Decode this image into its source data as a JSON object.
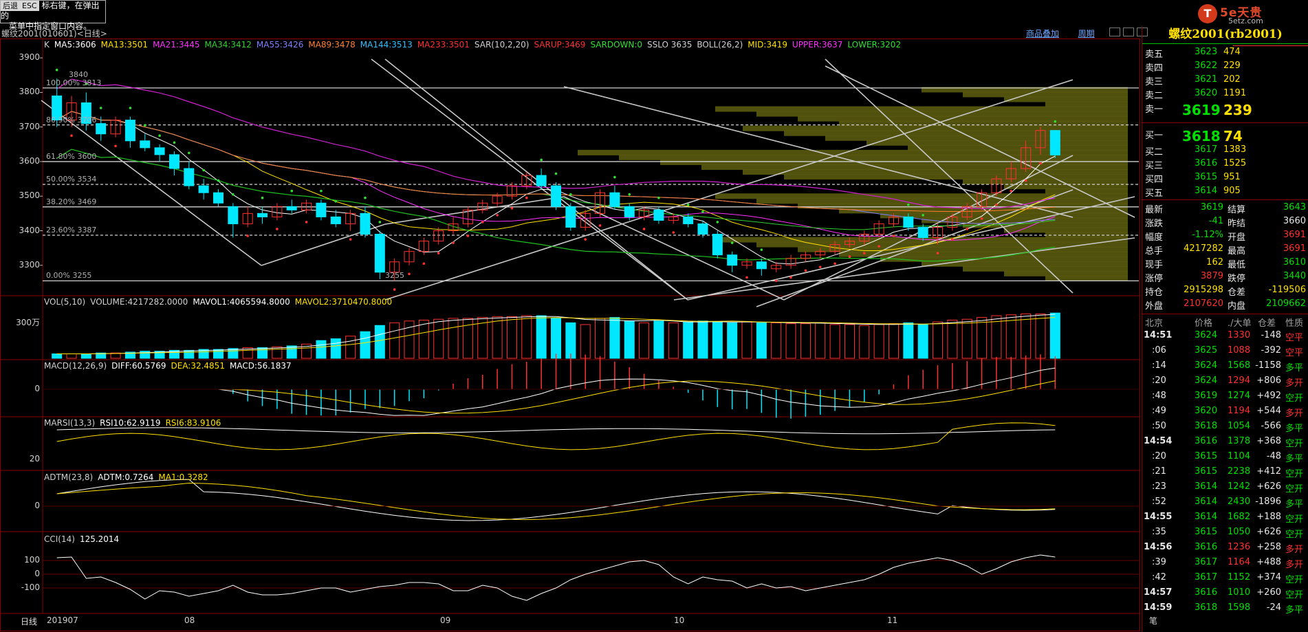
{
  "tip": {
    "back": "后退",
    "esc": "ESC",
    "text1": "标右键，在弹出的",
    "text2": "菜单中指定窗口内容。"
  },
  "logo": {
    "mark": "T",
    "brand": "5e天贵",
    "site": "5etz.com"
  },
  "header": {
    "symbol": "螺纹2001(010601)<日线>",
    "overlay": "商品叠加",
    "period": "周期"
  },
  "main_legend": [
    {
      "text": "K",
      "color": "#d0d0d0"
    },
    {
      "text": "MA5:3606",
      "color": "#ffffff"
    },
    {
      "text": "MA13:3501",
      "color": "#ffe000"
    },
    {
      "text": "MA21:3445",
      "color": "#ff30ff"
    },
    {
      "text": "MA34:3412",
      "color": "#30d030"
    },
    {
      "text": "MA55:3426",
      "color": "#8080ff"
    },
    {
      "text": "MA89:3478",
      "color": "#ff8030"
    },
    {
      "text": "MA144:3513",
      "color": "#30c0ff"
    },
    {
      "text": "MA233:3501",
      "color": "#ff3030"
    },
    {
      "text": "SAR(10,2,20)",
      "color": "#d0d0d0"
    },
    {
      "text": "SARUP:3469",
      "color": "#ff3030"
    },
    {
      "text": "SARDOWN:0",
      "color": "#30e030"
    },
    {
      "text": "SSLO 3635",
      "color": "#d0d0d0"
    },
    {
      "text": "BOLL(26,2)",
      "color": "#d0d0d0"
    },
    {
      "text": "MID:3419",
      "color": "#ffe000"
    },
    {
      "text": "UPPER:3637",
      "color": "#ff30ff"
    },
    {
      "text": "LOWER:3202",
      "color": "#30e030"
    }
  ],
  "main_yticks": [
    "3900",
    "3800",
    "3700",
    "3600",
    "3500",
    "3400",
    "3300"
  ],
  "fib_labels": [
    "100.00% 3813",
    "80.90% 3706",
    "61.80% 3600",
    "50.00% 3534",
    "38.20% 3469",
    "23.60% 3387",
    "0.00% 3255"
  ],
  "price_marks": [
    "3840",
    "3255"
  ],
  "vol_legend": [
    {
      "text": "VOL(5,10)",
      "color": "#d0d0d0"
    },
    {
      "text": "VOLUME:4217282.0000",
      "color": "#d0d0d0"
    },
    {
      "text": "MAVOL1:4065594.8000",
      "color": "#ffffff"
    },
    {
      "text": "MAVOL2:3710470.8000",
      "color": "#ffe000"
    }
  ],
  "vol_ytick": "300万",
  "macd_legend": [
    {
      "text": "MACD(12,26,9)",
      "color": "#d0d0d0"
    },
    {
      "text": "DIFF:60.5769",
      "color": "#ffffff"
    },
    {
      "text": "DEA:32.4851",
      "color": "#ffe000"
    },
    {
      "text": "MACD:56.1837",
      "color": "#ffffff"
    }
  ],
  "macd_ytick": "0",
  "rsi_legend": [
    {
      "text": "MARSI(13,3)",
      "color": "#d0d0d0"
    },
    {
      "text": "RSI10:62.9119",
      "color": "#ffffff"
    },
    {
      "text": "RSI6:83.9106",
      "color": "#ffe000"
    }
  ],
  "rsi_ytick": "20",
  "adtm_legend": [
    {
      "text": "ADTM(23,8)",
      "color": "#d0d0d0"
    },
    {
      "text": "ADTM:0.7264",
      "color": "#ffffff"
    },
    {
      "text": "MA1:0.3282",
      "color": "#ffe000"
    }
  ],
  "adtm_ytick": "0",
  "cci_legend": [
    {
      "text": "CCI(14)",
      "color": "#d0d0d0"
    },
    {
      "text": "125.2014",
      "color": "#ffffff"
    }
  ],
  "cci_yticks": [
    "100",
    "0",
    "-100"
  ],
  "xaxis": {
    "period_label": "日线",
    "ticks": [
      "201907",
      "08",
      "09",
      "10",
      "11"
    ]
  },
  "panel": {
    "title": "螺纹2001(rb2001)",
    "asks": [
      {
        "label": "卖五",
        "price": "3623",
        "vol": "474"
      },
      {
        "label": "卖四",
        "price": "3622",
        "vol": "229"
      },
      {
        "label": "卖三",
        "price": "3621",
        "vol": "202"
      },
      {
        "label": "卖二",
        "price": "3620",
        "vol": "1191"
      },
      {
        "label": "卖一",
        "price": "3619",
        "vol": "239"
      }
    ],
    "bids": [
      {
        "label": "买一",
        "price": "3618",
        "vol": "74"
      },
      {
        "label": "买二",
        "price": "3617",
        "vol": "1383"
      },
      {
        "label": "买三",
        "price": "3616",
        "vol": "1525"
      },
      {
        "label": "买四",
        "price": "3615",
        "vol": "951"
      },
      {
        "label": "买五",
        "price": "3614",
        "vol": "905"
      }
    ],
    "stats": [
      {
        "l1": "最新",
        "v1": "3619",
        "c1": "grn",
        "l2": "结算",
        "v2": "3643",
        "c2": "grn"
      },
      {
        "l1": "涨跌",
        "v1": "-41",
        "c1": "grn",
        "l2": "昨结",
        "v2": "3660",
        "c2": "wht"
      },
      {
        "l1": "幅度",
        "v1": "-1.12%",
        "c1": "grn",
        "l2": "开盘",
        "v2": "3691",
        "c2": "red"
      },
      {
        "l1": "总手",
        "v1": "4217282",
        "c1": "yel",
        "l2": "最高",
        "v2": "3691",
        "c2": "red"
      },
      {
        "l1": "现手",
        "v1": "162",
        "c1": "yel",
        "l2": "最低",
        "v2": "3610",
        "c2": "grn"
      },
      {
        "l1": "涨停",
        "v1": "3879",
        "c1": "red",
        "l2": "跌停",
        "v2": "3440",
        "c2": "grn"
      },
      {
        "l1": "持仓",
        "v1": "2915298",
        "c1": "yel",
        "l2": "仓差",
        "v2": "-119506",
        "c2": "yel"
      },
      {
        "l1": "外盘",
        "v1": "2107620",
        "c1": "red",
        "l2": "内盘",
        "v2": "2109662",
        "c2": "grn"
      }
    ],
    "ticks_header": {
      "time": "北京",
      "price": "价格",
      "vol": "./大单",
      "diff": "仓差",
      "nature": "性质"
    },
    "ticks": [
      {
        "t": "14:51",
        "p": "3624",
        "pc": "grn",
        "v": "1330",
        "vc": "red",
        "d": "-148",
        "n": "空平",
        "nc": "red"
      },
      {
        "t": ":06",
        "p": "3625",
        "pc": "grn",
        "v": "1088",
        "vc": "red",
        "d": "-392",
        "n": "空平",
        "nc": "red"
      },
      {
        "t": ":14",
        "p": "3624",
        "pc": "grn",
        "v": "1568",
        "vc": "grn",
        "d": "-1158",
        "n": "多平",
        "nc": "grn"
      },
      {
        "t": ":20",
        "p": "3624",
        "pc": "grn",
        "v": "1294",
        "vc": "red",
        "d": "+806",
        "n": "多开",
        "nc": "red"
      },
      {
        "t": ":48",
        "p": "3619",
        "pc": "grn",
        "v": "1274",
        "vc": "grn",
        "d": "+492",
        "n": "空开",
        "nc": "grn"
      },
      {
        "t": ":49",
        "p": "3620",
        "pc": "grn",
        "v": "1194",
        "vc": "red",
        "d": "+544",
        "n": "多开",
        "nc": "red"
      },
      {
        "t": ":50",
        "p": "3618",
        "pc": "grn",
        "v": "1054",
        "vc": "grn",
        "d": "-566",
        "n": "多平",
        "nc": "grn"
      },
      {
        "t": "14:54",
        "p": "3616",
        "pc": "grn",
        "v": "1378",
        "vc": "grn",
        "d": "+368",
        "n": "空开",
        "nc": "grn"
      },
      {
        "t": ":20",
        "p": "3615",
        "pc": "grn",
        "v": "1104",
        "vc": "grn",
        "d": "-48",
        "n": "多平",
        "nc": "grn"
      },
      {
        "t": ":21",
        "p": "3615",
        "pc": "grn",
        "v": "2238",
        "vc": "grn",
        "d": "+412",
        "n": "空开",
        "nc": "grn"
      },
      {
        "t": ":23",
        "p": "3614",
        "pc": "grn",
        "v": "1242",
        "vc": "grn",
        "d": "+626",
        "n": "空开",
        "nc": "grn"
      },
      {
        "t": ":52",
        "p": "3614",
        "pc": "grn",
        "v": "2430",
        "vc": "grn",
        "d": "-1896",
        "n": "多平",
        "nc": "grn"
      },
      {
        "t": "14:55",
        "p": "3614",
        "pc": "grn",
        "v": "1682",
        "vc": "grn",
        "d": "+188",
        "n": "空开",
        "nc": "grn"
      },
      {
        "t": ":35",
        "p": "3615",
        "pc": "grn",
        "v": "1050",
        "vc": "grn",
        "d": "+626",
        "n": "空开",
        "nc": "grn"
      },
      {
        "t": "14:56",
        "p": "3616",
        "pc": "grn",
        "v": "1236",
        "vc": "red",
        "d": "+258",
        "n": "多开",
        "nc": "red"
      },
      {
        "t": ":39",
        "p": "3617",
        "pc": "grn",
        "v": "1164",
        "vc": "red",
        "d": "+488",
        "n": "多开",
        "nc": "red"
      },
      {
        "t": ":42",
        "p": "3617",
        "pc": "grn",
        "v": "1152",
        "vc": "grn",
        "d": "+374",
        "n": "空开",
        "nc": "grn"
      },
      {
        "t": "14:57",
        "p": "3616",
        "pc": "grn",
        "v": "1010",
        "vc": "grn",
        "d": "+260",
        "n": "空开",
        "nc": "grn"
      },
      {
        "t": "14:59",
        "p": "3618",
        "pc": "grn",
        "v": "1598",
        "vc": "grn",
        "d": "-24",
        "n": "多平",
        "nc": "grn"
      }
    ],
    "footer_tab": "笔"
  },
  "chart_data": {
    "type": "candlestick",
    "title": "螺纹2001(010601)<日线>",
    "ylim": [
      3220,
      3940
    ],
    "x_ticks": [
      "201907",
      "08",
      "09",
      "10",
      "11"
    ],
    "candles": [
      {
        "o": 3790,
        "c": 3720,
        "h": 3840,
        "l": 3700
      },
      {
        "o": 3720,
        "c": 3770,
        "h": 3790,
        "l": 3700
      },
      {
        "o": 3770,
        "c": 3710,
        "h": 3800,
        "l": 3690
      },
      {
        "o": 3710,
        "c": 3680,
        "h": 3730,
        "l": 3660
      },
      {
        "o": 3680,
        "c": 3720,
        "h": 3730,
        "l": 3670
      },
      {
        "o": 3720,
        "c": 3660,
        "h": 3730,
        "l": 3640
      },
      {
        "o": 3660,
        "c": 3640,
        "h": 3680,
        "l": 3630
      },
      {
        "o": 3640,
        "c": 3620,
        "h": 3650,
        "l": 3600
      },
      {
        "o": 3620,
        "c": 3580,
        "h": 3630,
        "l": 3560
      },
      {
        "o": 3580,
        "c": 3530,
        "h": 3600,
        "l": 3520
      },
      {
        "o": 3530,
        "c": 3510,
        "h": 3550,
        "l": 3490
      },
      {
        "o": 3510,
        "c": 3480,
        "h": 3520,
        "l": 3470
      },
      {
        "o": 3470,
        "c": 3420,
        "h": 3480,
        "l": 3380
      },
      {
        "o": 3420,
        "c": 3450,
        "h": 3470,
        "l": 3410
      },
      {
        "o": 3450,
        "c": 3440,
        "h": 3470,
        "l": 3420
      },
      {
        "o": 3440,
        "c": 3470,
        "h": 3480,
        "l": 3430
      },
      {
        "o": 3470,
        "c": 3460,
        "h": 3490,
        "l": 3450
      },
      {
        "o": 3460,
        "c": 3480,
        "h": 3490,
        "l": 3450
      },
      {
        "o": 3480,
        "c": 3440,
        "h": 3490,
        "l": 3430
      },
      {
        "o": 3440,
        "c": 3420,
        "h": 3460,
        "l": 3410
      },
      {
        "o": 3420,
        "c": 3450,
        "h": 3460,
        "l": 3400
      },
      {
        "o": 3450,
        "c": 3390,
        "h": 3470,
        "l": 3380
      },
      {
        "o": 3390,
        "c": 3280,
        "h": 3400,
        "l": 3260
      },
      {
        "o": 3280,
        "c": 3310,
        "h": 3320,
        "l": 3255
      },
      {
        "o": 3310,
        "c": 3340,
        "h": 3350,
        "l": 3300
      },
      {
        "o": 3340,
        "c": 3370,
        "h": 3380,
        "l": 3330
      },
      {
        "o": 3370,
        "c": 3400,
        "h": 3410,
        "l": 3360
      },
      {
        "o": 3400,
        "c": 3420,
        "h": 3440,
        "l": 3390
      },
      {
        "o": 3420,
        "c": 3460,
        "h": 3470,
        "l": 3410
      },
      {
        "o": 3460,
        "c": 3480,
        "h": 3490,
        "l": 3450
      },
      {
        "o": 3480,
        "c": 3500,
        "h": 3510,
        "l": 3470
      },
      {
        "o": 3500,
        "c": 3530,
        "h": 3540,
        "l": 3490
      },
      {
        "o": 3530,
        "c": 3560,
        "h": 3570,
        "l": 3520
      },
      {
        "o": 3560,
        "c": 3530,
        "h": 3580,
        "l": 3520
      },
      {
        "o": 3530,
        "c": 3470,
        "h": 3540,
        "l": 3460
      },
      {
        "o": 3470,
        "c": 3410,
        "h": 3480,
        "l": 3400
      },
      {
        "o": 3410,
        "c": 3450,
        "h": 3460,
        "l": 3400
      },
      {
        "o": 3450,
        "c": 3510,
        "h": 3520,
        "l": 3440
      },
      {
        "o": 3510,
        "c": 3470,
        "h": 3530,
        "l": 3460
      },
      {
        "o": 3470,
        "c": 3440,
        "h": 3480,
        "l": 3430
      },
      {
        "o": 3440,
        "c": 3460,
        "h": 3470,
        "l": 3430
      },
      {
        "o": 3460,
        "c": 3430,
        "h": 3470,
        "l": 3420
      },
      {
        "o": 3430,
        "c": 3440,
        "h": 3450,
        "l": 3420
      },
      {
        "o": 3440,
        "c": 3420,
        "h": 3450,
        "l": 3410
      },
      {
        "o": 3420,
        "c": 3390,
        "h": 3430,
        "l": 3380
      },
      {
        "o": 3390,
        "c": 3330,
        "h": 3400,
        "l": 3320
      },
      {
        "o": 3330,
        "c": 3300,
        "h": 3340,
        "l": 3280
      },
      {
        "o": 3300,
        "c": 3310,
        "h": 3320,
        "l": 3290
      },
      {
        "o": 3310,
        "c": 3290,
        "h": 3320,
        "l": 3270
      },
      {
        "o": 3290,
        "c": 3300,
        "h": 3310,
        "l": 3280
      },
      {
        "o": 3300,
        "c": 3320,
        "h": 3330,
        "l": 3290
      },
      {
        "o": 3320,
        "c": 3330,
        "h": 3340,
        "l": 3310
      },
      {
        "o": 3330,
        "c": 3340,
        "h": 3350,
        "l": 3320
      },
      {
        "o": 3340,
        "c": 3360,
        "h": 3370,
        "l": 3330
      },
      {
        "o": 3360,
        "c": 3370,
        "h": 3380,
        "l": 3350
      },
      {
        "o": 3370,
        "c": 3390,
        "h": 3400,
        "l": 3360
      },
      {
        "o": 3390,
        "c": 3420,
        "h": 3430,
        "l": 3380
      },
      {
        "o": 3420,
        "c": 3440,
        "h": 3450,
        "l": 3410
      },
      {
        "o": 3440,
        "c": 3410,
        "h": 3450,
        "l": 3400
      },
      {
        "o": 3410,
        "c": 3380,
        "h": 3420,
        "l": 3370
      },
      {
        "o": 3380,
        "c": 3410,
        "h": 3420,
        "l": 3360
      },
      {
        "o": 3410,
        "c": 3440,
        "h": 3450,
        "l": 3400
      },
      {
        "o": 3440,
        "c": 3470,
        "h": 3480,
        "l": 3430
      },
      {
        "o": 3470,
        "c": 3510,
        "h": 3520,
        "l": 3460
      },
      {
        "o": 3510,
        "c": 3550,
        "h": 3560,
        "l": 3500
      },
      {
        "o": 3550,
        "c": 3580,
        "h": 3600,
        "l": 3540
      },
      {
        "o": 3580,
        "c": 3640,
        "h": 3660,
        "l": 3570
      },
      {
        "o": 3640,
        "c": 3690,
        "h": 3700,
        "l": 3620
      },
      {
        "o": 3690,
        "c": 3619,
        "h": 3691,
        "l": 3610
      }
    ],
    "volume": [
      5,
      5,
      5,
      6,
      6,
      7,
      8,
      8,
      9,
      9,
      10,
      10,
      11,
      12,
      12,
      13,
      14,
      16,
      20,
      22,
      25,
      30,
      37,
      40,
      42,
      43,
      44,
      45,
      45,
      46,
      47,
      47,
      48,
      48,
      45,
      40,
      38,
      45,
      46,
      42,
      40,
      42,
      40,
      41,
      42,
      41,
      40,
      41,
      40,
      40,
      39,
      39,
      40,
      38,
      38,
      37,
      38,
      39,
      40,
      38,
      41,
      43,
      44,
      46,
      48,
      49,
      50,
      50,
      51
    ],
    "volume_unit": "万手",
    "cci": [
      120,
      125,
      -30,
      -20,
      -60,
      -110,
      -180,
      -120,
      -130,
      -160,
      -140,
      -120,
      -80,
      -130,
      -150,
      -150,
      -140,
      -120,
      -100,
      -100,
      -130,
      -110,
      -90,
      -80,
      -60,
      -60,
      -70,
      -120,
      -120,
      -80,
      -100,
      -160,
      -190,
      -140,
      -100,
      -40,
      0,
      30,
      60,
      90,
      100,
      70,
      -20,
      -70,
      -20,
      -40,
      -50,
      -100,
      -70,
      -100,
      -90,
      -120,
      -100,
      -80,
      -60,
      -40,
      0,
      50,
      80,
      100,
      120,
      100,
      60,
      0,
      40,
      90,
      120,
      140,
      125
    ]
  }
}
